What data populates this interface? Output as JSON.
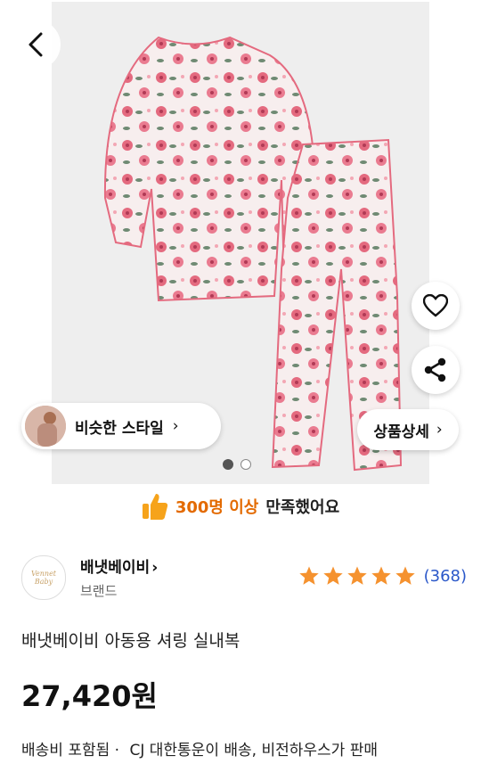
{
  "gallery": {
    "similar_label": "비슷한 스타일",
    "detail_label": "상품상세",
    "dots": [
      true,
      false
    ]
  },
  "satisfaction": {
    "highlight": "300명 이상",
    "rest": "만족했어요"
  },
  "seller": {
    "name": "배냇베이비",
    "sub": "브랜드",
    "logo_text": "Vennet Baby",
    "rating_stars": 5,
    "rating_count": "(368)"
  },
  "product": {
    "title": "배냇베이비 아동용 셔링 실내복",
    "price": "27,420원",
    "shipping_prefix": "배송비 포함됨 ·",
    "shipping_info": "CJ 대한통운이 배송, 비전하우스가 판매"
  },
  "colors": {
    "accent_orange": "#e36a00",
    "rating_blue": "#2b58c9",
    "star": "#f5922f"
  }
}
